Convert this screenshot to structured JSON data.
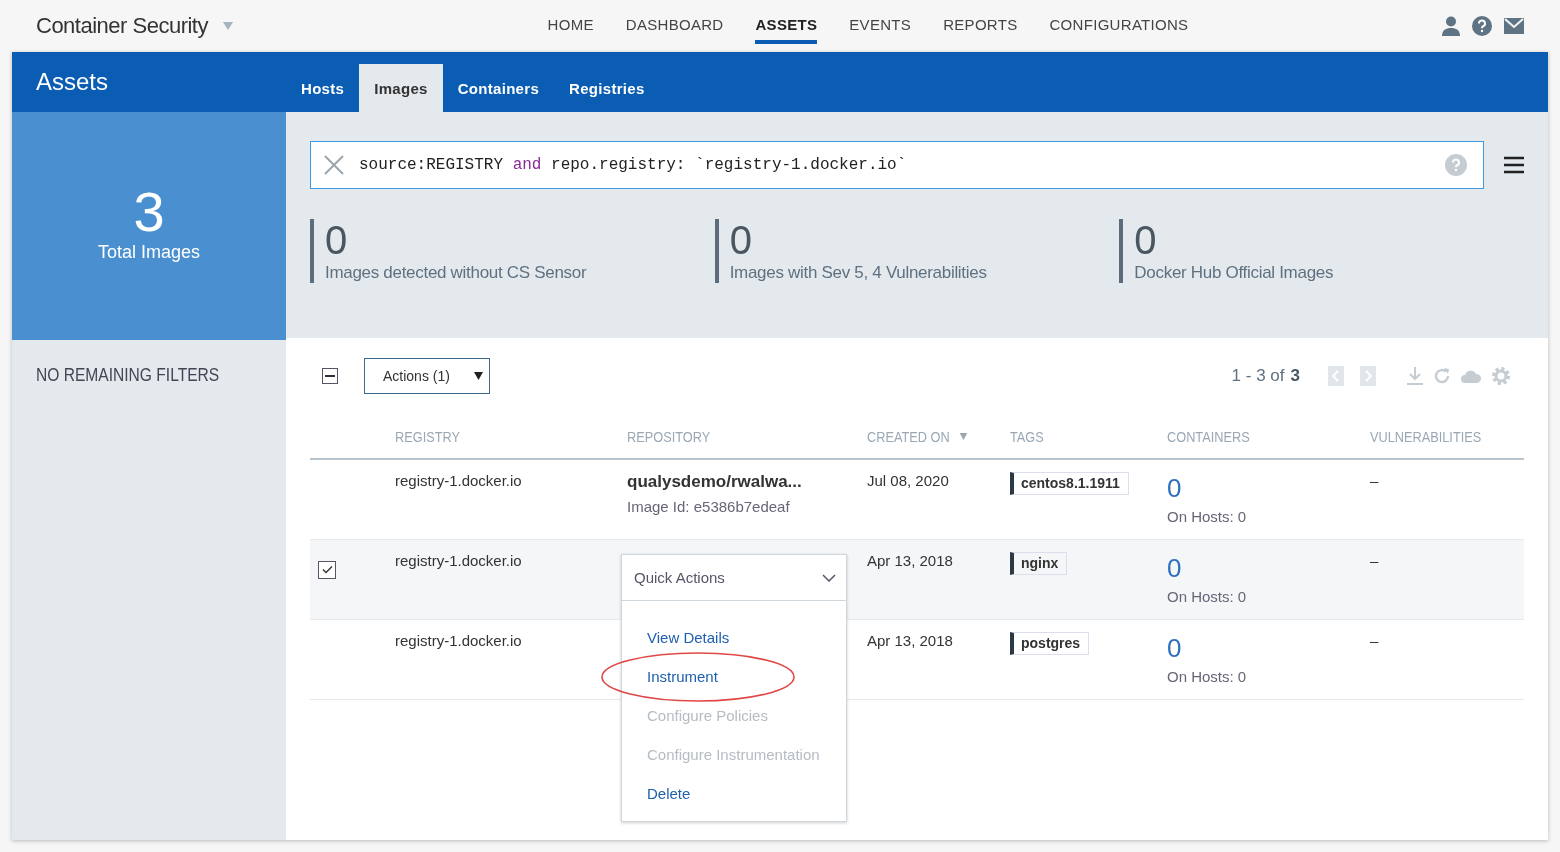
{
  "header": {
    "product": "Container Security",
    "nav": [
      {
        "label": "HOME",
        "selected": false
      },
      {
        "label": "DASHBOARD",
        "selected": false
      },
      {
        "label": "ASSETS",
        "selected": true
      },
      {
        "label": "EVENTS",
        "selected": false
      },
      {
        "label": "REPORTS",
        "selected": false
      },
      {
        "label": "CONFIGURATIONS",
        "selected": false
      }
    ]
  },
  "section": {
    "title": "Assets",
    "tabs": [
      {
        "label": "Hosts",
        "selected": false
      },
      {
        "label": "Images",
        "selected": true
      },
      {
        "label": "Containers",
        "selected": false
      },
      {
        "label": "Registries",
        "selected": false
      }
    ]
  },
  "summary": {
    "count": "3",
    "label": "Total Images"
  },
  "filters_label": "NO REMAINING FILTERS",
  "search": {
    "tokens": [
      {
        "text": "source:REGISTRY ",
        "kind": "plain"
      },
      {
        "text": "and",
        "kind": "keyword"
      },
      {
        "text": " repo.registry: `registry-1.docker.io`",
        "kind": "plain"
      }
    ]
  },
  "stats": [
    {
      "value": "0",
      "label": "Images detected without CS Sensor"
    },
    {
      "value": "0",
      "label": "Images with Sev 5, 4 Vulnerabilities"
    },
    {
      "value": "0",
      "label": "Docker Hub Official Images"
    }
  ],
  "toolbar": {
    "select_all": {
      "partial": true
    },
    "actions": "Actions (1)",
    "range": "1 - 3 of",
    "total": "3"
  },
  "columns": [
    {
      "label": "REGISTRY",
      "sorted": false
    },
    {
      "label": "REPOSITORY",
      "sorted": false
    },
    {
      "label": "CREATED ON",
      "sorted": true
    },
    {
      "label": "TAGS",
      "sorted": false
    },
    {
      "label": "CONTAINERS",
      "sorted": false
    },
    {
      "label": "VULNERABILITIES",
      "sorted": false
    }
  ],
  "rows": [
    {
      "selected": false,
      "registry": "registry-1.docker.io",
      "repository": "qualysdemo/rwalwa...",
      "image_id": "Image Id: e5386b7edeaf",
      "created": "Jul 08, 2020",
      "tag": "centos8.1.1911",
      "containers": "0",
      "hosts": "On Hosts: 0",
      "vulnerabilities": "–"
    },
    {
      "selected": true,
      "registry": "registry-1.docker.io",
      "created": "Apr 13, 2018",
      "tag": "nginx",
      "containers": "0",
      "hosts": "On Hosts: 0",
      "vulnerabilities": "–"
    },
    {
      "selected": false,
      "registry": "registry-1.docker.io",
      "created": "Apr 13, 2018",
      "tag": "postgres",
      "containers": "0",
      "hosts": "On Hosts: 0",
      "vulnerabilities": "–"
    }
  ],
  "menu": {
    "title": "Quick Actions",
    "items": [
      {
        "label": "View Details",
        "disabled": false,
        "highlighted": false
      },
      {
        "label": "Instrument",
        "disabled": false,
        "highlighted": true
      },
      {
        "label": "Configure Policies",
        "disabled": true,
        "highlighted": false
      },
      {
        "label": "Configure Instrumentation",
        "disabled": true,
        "highlighted": false
      },
      {
        "label": "Delete",
        "disabled": false,
        "highlighted": false
      }
    ]
  }
}
